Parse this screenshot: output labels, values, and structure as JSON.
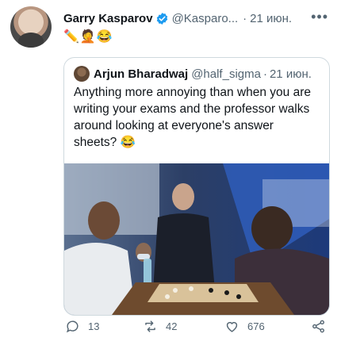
{
  "author": {
    "name": "Garry Kasparov",
    "handle": "@Kasparo...",
    "date": "21 июн.",
    "emojis": "✏️🤦😂"
  },
  "quoted": {
    "name": "Arjun Bharadwaj",
    "handle": "@half_sigma",
    "date": "21 июн.",
    "text": "Anything more annoying than when you are writing your exams and the professor walks around looking at everyone's answer sheets? 😂"
  },
  "actions": {
    "replies": "13",
    "retweets": "42",
    "likes": "676"
  },
  "colors": {
    "verified": "#1d9bf0",
    "muted": "#536471",
    "border": "#cfd9de"
  }
}
